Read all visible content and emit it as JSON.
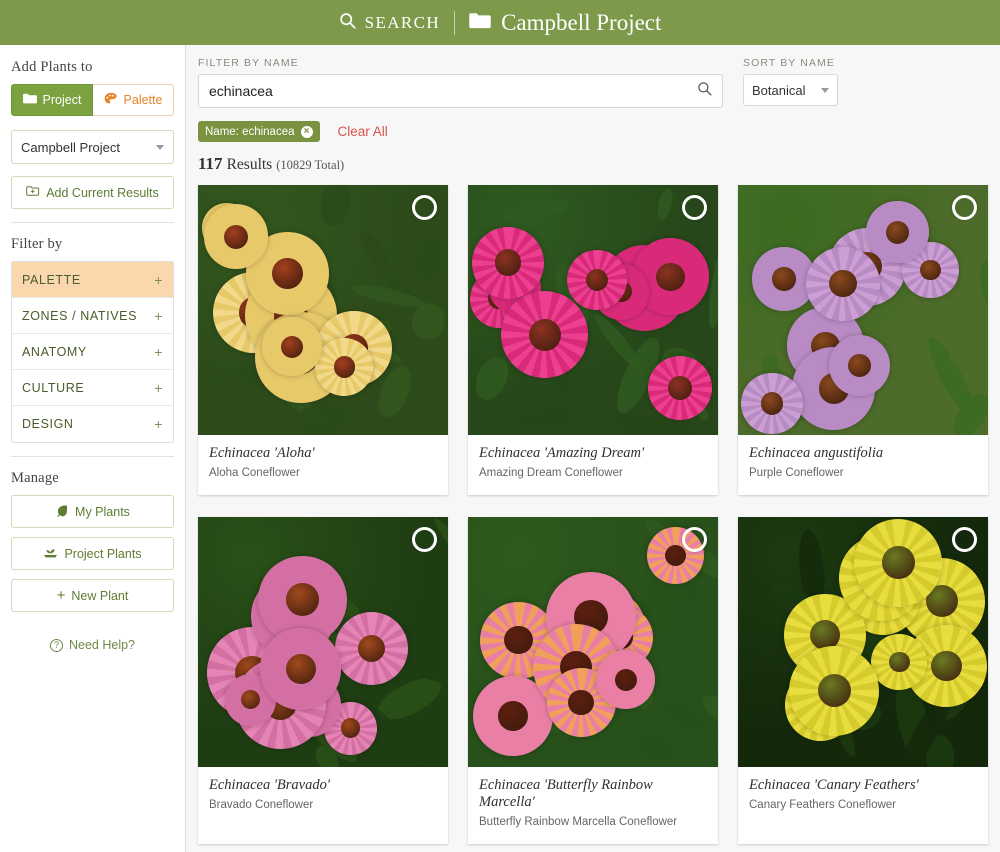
{
  "header": {
    "search_label": "SEARCH",
    "search_icon": "magnifier-icon",
    "divider": "|",
    "folder_icon": "folder-icon",
    "project_name": "Campbell Project"
  },
  "sidebar": {
    "add_plants_heading": "Add Plants to",
    "segments": [
      {
        "label": "Project",
        "icon": "folder-icon",
        "active": true
      },
      {
        "label": "Palette",
        "icon": "palette-icon",
        "active": false
      }
    ],
    "project_select": {
      "value": "Campbell Project"
    },
    "add_results_button": {
      "label": "Add Current Results",
      "icon": "add-folder-icon"
    },
    "filter_by_heading": "Filter by",
    "filters": [
      {
        "label": "PALETTE",
        "expander": "+",
        "selected": true
      },
      {
        "label": "ZONES / NATIVES",
        "expander": "+",
        "selected": false
      },
      {
        "label": "ANATOMY",
        "expander": "+",
        "selected": false
      },
      {
        "label": "CULTURE",
        "expander": "+",
        "selected": false
      },
      {
        "label": "DESIGN",
        "expander": "+",
        "selected": false
      }
    ],
    "manage_heading": "Manage",
    "manage_buttons": [
      {
        "label": "My Plants",
        "icon": "leaf-icon"
      },
      {
        "label": "Project Plants",
        "icon": "seedling-icon"
      },
      {
        "label": "New Plant",
        "icon": "plus-icon"
      }
    ],
    "help": {
      "label": "Need Help?",
      "icon": "question-circle-icon"
    }
  },
  "filter_bar": {
    "name_label": "FILTER BY NAME",
    "name_value": "echinacea",
    "name_placeholder": "Filter by name",
    "search_icon": "magnifier-icon",
    "sort_label": "SORT BY NAME",
    "sort_value": "Botanical",
    "chip": {
      "label": "Name: echinacea",
      "remove_icon": "close-circle-icon"
    },
    "clear_all": "Clear All",
    "results_count": "117",
    "results_word": "Results",
    "results_total": "(10829 Total)"
  },
  "colors": {
    "header_green": "#7d9a4b",
    "accent_green": "#7ba23f",
    "palette_orange": "#e8832a",
    "selected_filter": "#fad7ad",
    "clear_red": "#d9534f"
  },
  "plants": [
    {
      "botanical": "Echinacea 'Aloha'",
      "common": "Aloha Coneflower",
      "select_icon": "circle-select-icon",
      "photo": {
        "petal": "#f2d98a",
        "petal2": "#e8c96a",
        "cone": "#a33f1e",
        "leaf": "#33571f",
        "bg": "#2c4a1a"
      }
    },
    {
      "botanical": "Echinacea 'Amazing Dream'",
      "common": "Amazing Dream Coneflower",
      "select_icon": "circle-select-icon",
      "photo": {
        "petal": "#ec3f8f",
        "petal2": "#d82a79",
        "cone": "#8c3322",
        "leaf": "#2f5a20",
        "bg": "#27471a"
      }
    },
    {
      "botanical": "Echinacea angustifolia",
      "common": "Purple Coneflower",
      "select_icon": "circle-select-icon",
      "photo": {
        "petal": "#cb9fd3",
        "petal2": "#b88bc4",
        "cone": "#8a4a1e",
        "leaf": "#3b6b22",
        "bg": "#4d6b2a"
      }
    },
    {
      "botanical": "Echinacea 'Bravado'",
      "common": "Bravado Coneflower",
      "select_icon": "circle-select-icon",
      "photo": {
        "petal": "#e585b5",
        "petal2": "#d46fa3",
        "cone": "#a04a1c",
        "leaf": "#2a5018",
        "bg": "#1f3d13"
      }
    },
    {
      "botanical": "Echinacea 'Butterfly Rainbow Marcella'",
      "common": "Butterfly Rainbow Marcella Coneflower",
      "select_icon": "circle-select-icon",
      "photo": {
        "petal": "#f0a05a",
        "petal2": "#ea7fa6",
        "cone": "#5d1f10",
        "leaf": "#2e5a1d",
        "bg": "#27501a"
      }
    },
    {
      "botanical": "Echinacea 'Canary Feathers'",
      "common": "Canary Feathers Coneflower",
      "select_icon": "circle-select-icon",
      "photo": {
        "petal": "#e8dd3f",
        "petal2": "#d6cb2c",
        "cone": "#6a7a22",
        "leaf": "#1c3a10",
        "bg": "#14290c"
      }
    }
  ]
}
